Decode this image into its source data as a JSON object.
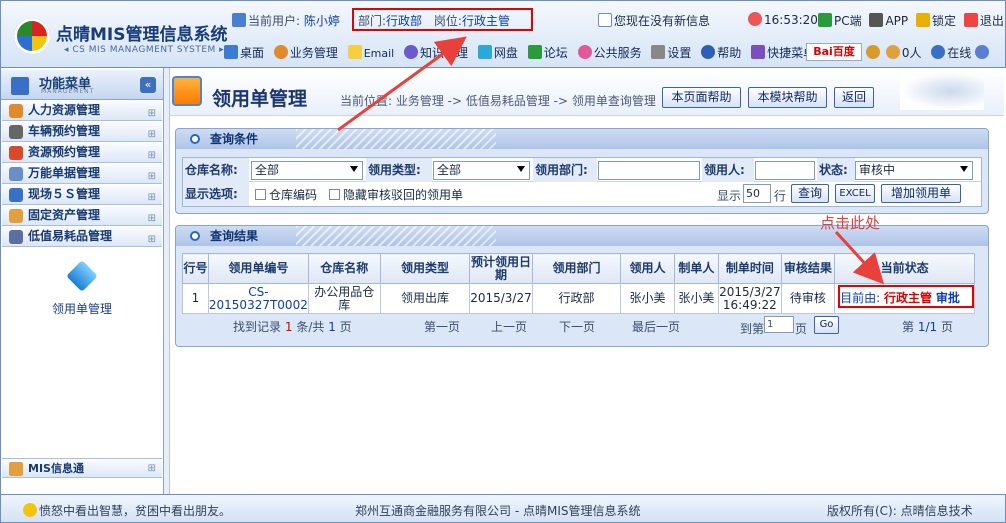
{
  "app": {
    "name": "点晴MIS管理信息系统",
    "subtitle": "CS MIS MANAGMENT SYSTEM"
  },
  "header": {
    "current_user_label": "当前用户:",
    "current_user": "陈小婷",
    "dept_label": "部门:",
    "dept": "行政部",
    "post_label": "岗位:",
    "post": "行政主管",
    "message": "您现在没有新信息",
    "time": "16:53:20",
    "right_items": [
      "PC端",
      "APP",
      "锁定",
      "退出"
    ],
    "online_count": "0人",
    "online_label": "在线",
    "search_brand": "Bai百度"
  },
  "menu": [
    "桌面",
    "业务管理",
    "Email",
    "知识管理",
    "网盘",
    "论坛",
    "公共服务",
    "设置",
    "帮助",
    "快捷菜单"
  ],
  "sidebar": {
    "title": "功能菜单",
    "title_sub": "MANAGEMENT",
    "collapse": "«",
    "items": [
      "人力资源管理",
      "车辆预约管理",
      "资源预约管理",
      "万能单据管理",
      "现场５Ｓ管理",
      "固定资产管理",
      "低值易耗品管理"
    ],
    "sub_item": "领用单管理",
    "mis_item": "MIS信息通"
  },
  "page": {
    "title": "领用单管理",
    "breadcrumb": "当前位置: 业务管理 -> 低值易耗品管理 -> 领用单查询管理",
    "btn_page_help": "本页面帮助",
    "btn_module_help": "本模块帮助",
    "btn_back": "返回"
  },
  "query": {
    "title": "查询条件",
    "warehouse_label": "仓库名称:",
    "warehouse_value": "全部",
    "type_label": "领用类型:",
    "type_value": "全部",
    "dept_label": "领用部门:",
    "dept_value": "",
    "person_label": "领用人:",
    "person_value": "",
    "status_label": "状态:",
    "status_value": "审核中",
    "options_label": "显示选项:",
    "opt1": "仓库编码",
    "opt2": "隐藏审核驳回的领用单",
    "show_label": "显示",
    "show_value": "50",
    "row_label": "行",
    "btn_query": "查询",
    "btn_excel": "EXCEL",
    "btn_add": "增加领用单"
  },
  "results": {
    "title": "查询结果",
    "headers": [
      "行号",
      "领用单编号",
      "仓库名称",
      "领用类型",
      "预计领用日期",
      "领用部门",
      "领用人",
      "制单人",
      "制单时间",
      "审核结果",
      "当前状态"
    ],
    "rows": [
      {
        "no": "1",
        "code": "CS-20150327T0002",
        "warehouse": "办公用品仓库",
        "type": "领用出库",
        "date": "2015/3/27",
        "dept": "行政部",
        "person": "张小美",
        "maker": "张小美",
        "time": "2015/3/27 16:49:22",
        "result": "待审核",
        "status_prefix": "目前由:",
        "status_role": "行政主管",
        "status_action": "审批"
      }
    ],
    "pager": {
      "found": "找到记录",
      "count": "1",
      "unit": "条/共",
      "pages": "1",
      "page_unit": "页",
      "first": "第一页",
      "prev": "上一页",
      "next": "下一页",
      "last": "最后一页",
      "goto": "到第",
      "goto_value": "1",
      "goto_unit": "页",
      "go": "Go",
      "page_label": "第",
      "page_cur": "1/1",
      "page_end": "页"
    }
  },
  "annotation": "点击此处",
  "footer": {
    "tip": "愤怒中看出智慧，贫困中看出朋友。",
    "company": "郑州互通商金融服务有限公司 - 点晴MIS管理信息系统",
    "copyright": "版权所有(C): 点晴信息技术"
  }
}
